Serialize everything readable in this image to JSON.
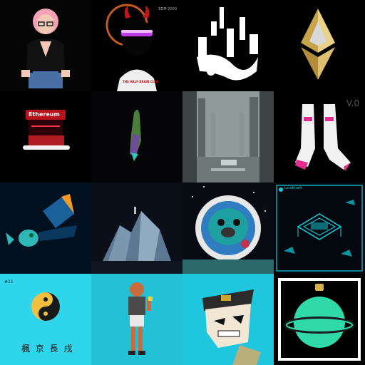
{
  "tiles": [
    {
      "id": "pink-hair-avatar",
      "bg": "#050505"
    },
    {
      "id": "devil-hoodie",
      "bg": "#000000",
      "corner_text": "EDM 2000",
      "hoodie_text": "THE HALF BRAIN CLUB"
    },
    {
      "id": "abstract-splash",
      "bg": "#000000"
    },
    {
      "id": "ethereum-gold",
      "bg": "#000000"
    },
    {
      "id": "ethereum-sign",
      "bg": "#000000",
      "sign_text": "Ethereum"
    },
    {
      "id": "green-crystal",
      "bg": "#050507"
    },
    {
      "id": "misty-lake",
      "bg": "#8f9a9a"
    },
    {
      "id": "socks",
      "bg": "#000000",
      "version_text": "V.0"
    },
    {
      "id": "blue-fish",
      "bg": "#031020"
    },
    {
      "id": "iceberg",
      "bg": "#0a0f1a"
    },
    {
      "id": "astronaut-pug",
      "bg": "#0a0a12"
    },
    {
      "id": "landmark",
      "bg": "#02080d",
      "header_text": "Landmark"
    },
    {
      "id": "yin-yang",
      "bg": "#2fd5ea",
      "number_text": "#11",
      "glyph_text": "楓 京 長 戌"
    },
    {
      "id": "character",
      "bg": "#23c0d6"
    },
    {
      "id": "anime-face",
      "bg": "#1fc6de"
    },
    {
      "id": "green-planet",
      "bg": "#000000"
    }
  ]
}
